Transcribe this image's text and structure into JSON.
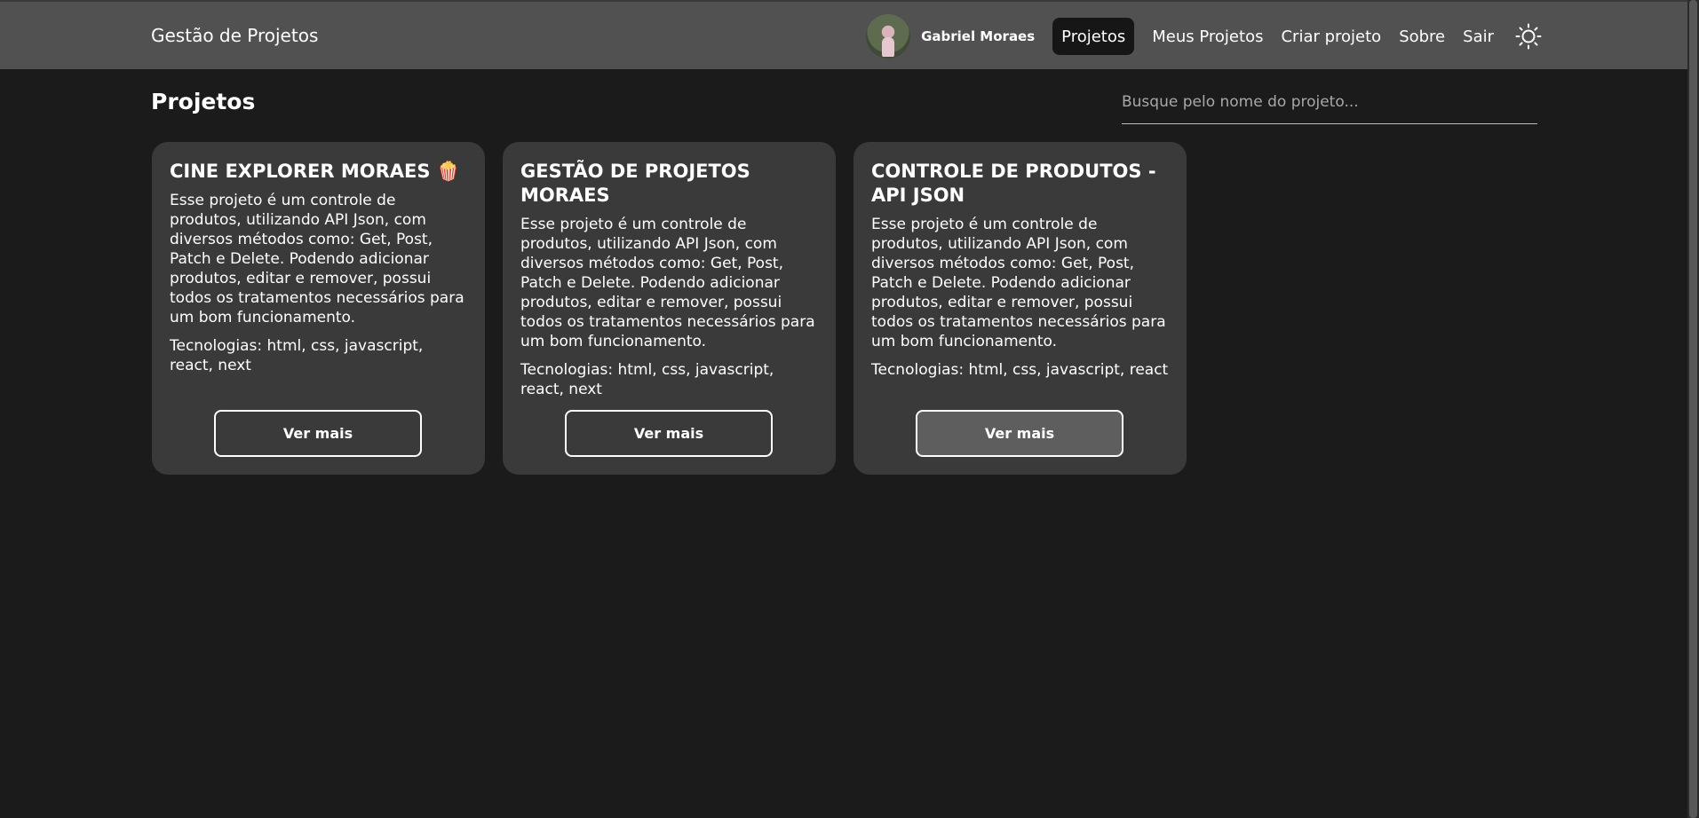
{
  "navbar": {
    "brand": "Gestão de Projetos",
    "user_name": "Gabriel Moraes",
    "links": [
      {
        "label": "Projetos",
        "active": true
      },
      {
        "label": "Meus Projetos",
        "active": false
      },
      {
        "label": "Criar projeto",
        "active": false
      },
      {
        "label": "Sobre",
        "active": false
      },
      {
        "label": "Sair",
        "active": false
      }
    ],
    "theme_icon": "sun-icon"
  },
  "main": {
    "title": "Projetos",
    "search": {
      "placeholder": "Busque pelo nome do projeto...",
      "value": ""
    }
  },
  "cards": [
    {
      "title": "CINE EXPLORER MORAES 🍿",
      "description": "Esse projeto é um controle de produtos, utilizando API Json, com diversos métodos como: Get, Post, Patch e Delete. Podendo adicionar produtos, editar e remover, possui todos os tratamentos necessários para um bom funcionamento.",
      "tech": "Tecnologias: html, css, javascript, react, next",
      "button": "Ver mais"
    },
    {
      "title": "GESTÃO DE PROJETOS MORAES",
      "description": "Esse projeto é um controle de produtos, utilizando API Json, com diversos métodos como: Get, Post, Patch e Delete. Podendo adicionar produtos, editar e remover, possui todos os tratamentos necessários para um bom funcionamento.",
      "tech": "Tecnologias: html, css, javascript, react, next",
      "button": "Ver mais"
    },
    {
      "title": "CONTROLE DE PRODUTOS - API JSON",
      "description": "Esse projeto é um controle de produtos, utilizando API Json, com diversos métodos como: Get, Post, Patch e Delete. Podendo adicionar produtos, editar e remover, possui todos os tratamentos necessários para um bom funcionamento.",
      "tech": "Tecnologias: html, css, javascript, react",
      "button": "Ver mais"
    }
  ],
  "colors": {
    "background": "#1b1b1b",
    "navbar": "#515151",
    "card": "#3a3a3a",
    "active_link": "#161616",
    "button_hover": "#5e5e5e"
  }
}
